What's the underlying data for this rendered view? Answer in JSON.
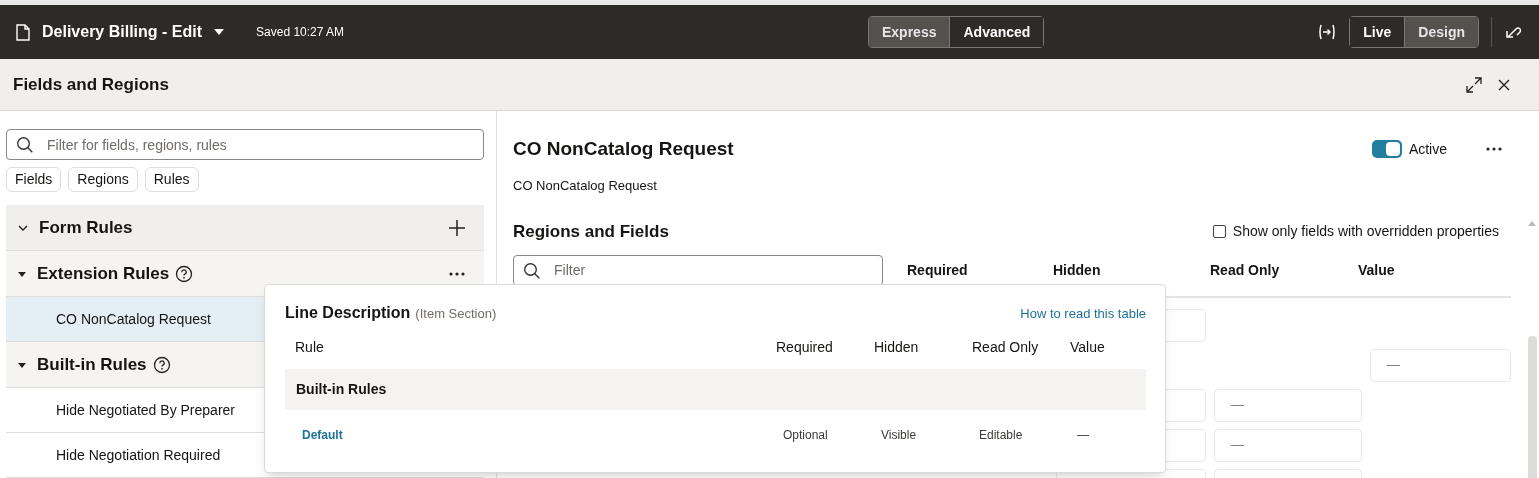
{
  "top_bar": {
    "title": "Delivery Billing - Edit",
    "saved": "Saved 10:27 AM",
    "mode_tabs": [
      {
        "label": "Express",
        "selected": false
      },
      {
        "label": "Advanced",
        "selected": true
      }
    ],
    "view_tabs": [
      {
        "label": "Live",
        "selected": true
      },
      {
        "label": "Design",
        "selected": false
      }
    ]
  },
  "panel": {
    "title": "Fields and Regions"
  },
  "left": {
    "search": {
      "placeholder": "Filter for fields, regions, rules"
    },
    "chips": [
      {
        "label": "Fields",
        "selected": false
      },
      {
        "label": "Regions",
        "selected": false
      },
      {
        "label": "Rules",
        "selected": false
      }
    ],
    "tree": [
      {
        "label": "Form Rules",
        "kind": "root",
        "expanded": true,
        "help": false
      },
      {
        "label": "Extension Rules",
        "kind": "menu",
        "expanded": true,
        "help": true,
        "children": [
          {
            "label": "CO NonCatalog Request",
            "selected": true
          }
        ]
      },
      {
        "label": "Built-in Rules",
        "kind": "plain",
        "expanded": true,
        "help": true,
        "children": [
          {
            "label": "Hide Negotiated By Preparer",
            "selected": false
          },
          {
            "label": "Hide Negotiation Required",
            "selected": false
          }
        ]
      }
    ]
  },
  "rule": {
    "title": "CO NonCatalog Request",
    "description": "CO NonCatalog Request",
    "active": {
      "label": "Active",
      "on": true
    },
    "section_title": "Regions and Fields",
    "override_filter": {
      "label": "Show only fields with overridden properties",
      "checked": false
    },
    "filter": {
      "placeholder": "Filter"
    },
    "columns": [
      "Required",
      "Hidden",
      "Read Only",
      "Value"
    ],
    "rows": [
      {
        "boxes": [
          {
            "kind": "hidden"
          }
        ]
      },
      {
        "boxes": [
          {
            "kind": "value",
            "text": "—"
          }
        ]
      },
      {
        "boxes": [
          {
            "kind": "hidden"
          },
          {
            "kind": "readonly",
            "text": "—"
          }
        ]
      },
      {
        "boxes": [
          {
            "kind": "hidden"
          },
          {
            "kind": "readonly",
            "text": "—"
          }
        ]
      },
      {
        "boxes": [
          {
            "kind": "hidden"
          },
          {
            "kind": "readonly"
          }
        ]
      }
    ]
  },
  "popup": {
    "title": "Line Description",
    "subtitle": "(Item Section)",
    "link": "How to read this table",
    "columns": [
      "Rule",
      "Required",
      "Hidden",
      "Read Only",
      "Value"
    ],
    "group": "Built-in Rules",
    "rows": [
      {
        "rule": "Default",
        "required": "Optional",
        "hidden": "Visible",
        "read_only": "Editable",
        "value": "—"
      }
    ]
  }
}
